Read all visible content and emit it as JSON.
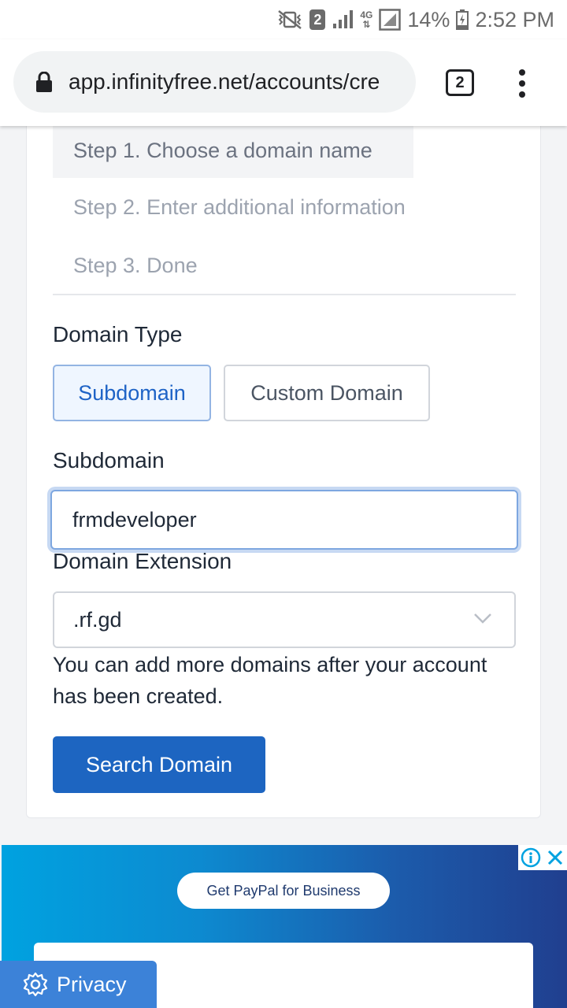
{
  "status_bar": {
    "sim_slot": "2",
    "network": "4G",
    "battery": "14%",
    "time": "2:52 PM"
  },
  "browser": {
    "url": "app.infinityfree.net/accounts/cre",
    "tab_count": "2"
  },
  "steps": [
    {
      "label": "Step 1. Choose a domain name"
    },
    {
      "label": "Step 2. Enter additional information"
    },
    {
      "label": "Step 3. Done"
    }
  ],
  "form": {
    "domain_type_label": "Domain Type",
    "domain_type_options": [
      "Subdomain",
      "Custom Domain"
    ],
    "selected_domain_type": "Subdomain",
    "subdomain_label": "Subdomain",
    "subdomain_value": "frmdeveloper",
    "extension_label": "Domain Extension",
    "extension_value": ".rf.gd",
    "help_text": "You can add more domains after your account has been created.",
    "submit_label": "Search Domain"
  },
  "ad": {
    "cta_label": "Get PayPal for Business"
  },
  "privacy": {
    "label": "Privacy"
  },
  "colors": {
    "primary": "#1d65c1",
    "ad_gradient_start": "#00a2e0",
    "ad_gradient_end": "#203f8f"
  }
}
